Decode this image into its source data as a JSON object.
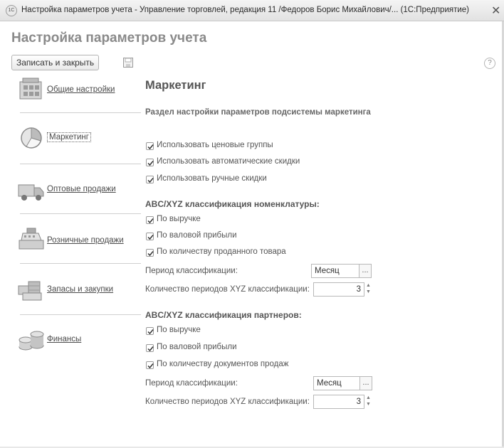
{
  "window": {
    "title": "Настройка параметров учета - Управление торговлей, редакция 11 /Федоров Борис Михайлович/... (1С:Предприятие)",
    "close_glyph": "✕",
    "logo_text": "1С"
  },
  "form": {
    "title": "Настройка параметров учета",
    "save_close_label": "Записать и закрыть",
    "help_glyph": "?"
  },
  "nav": {
    "items": [
      {
        "label": "Общие настройки",
        "icon": "general-settings-icon"
      },
      {
        "label": "Маркетинг",
        "icon": "marketing-icon",
        "active": true
      },
      {
        "label": "Оптовые продажи",
        "icon": "truck-icon"
      },
      {
        "label": "Розничные продажи",
        "icon": "cash-register-icon"
      },
      {
        "label": "Запасы и закупки",
        "icon": "warehouse-icon"
      },
      {
        "label": "Финансы",
        "icon": "coins-icon"
      }
    ]
  },
  "content": {
    "section_title": "Маркетинг",
    "section_subtitle": "Раздел настройки параметров подсистемы маркетинга",
    "general_checkboxes": [
      {
        "label": "Использовать ценовые группы",
        "checked": true
      },
      {
        "label": "Использовать автоматические скидки",
        "checked": true
      },
      {
        "label": "Использовать ручные скидки",
        "checked": true
      }
    ],
    "nomenclature_group": {
      "title": "ABC/XYZ классификация номенклатуры:",
      "checkboxes": [
        {
          "label": "По выручке",
          "checked": true
        },
        {
          "label": "По валовой прибыли",
          "checked": true
        },
        {
          "label": "По количеству проданного товара",
          "checked": true
        }
      ],
      "period_label": "Период классификации:",
      "period_value": "Месяц",
      "count_label": "Количество периодов XYZ классификации:",
      "count_value": "3"
    },
    "partners_group": {
      "title": "ABC/XYZ классификация партнеров:",
      "checkboxes": [
        {
          "label": "По выручке",
          "checked": true
        },
        {
          "label": "По валовой прибыли",
          "checked": true
        },
        {
          "label": "По количеству документов продаж",
          "checked": true
        }
      ],
      "period_label": "Период классификации:",
      "period_value": "Месяц",
      "count_label": "Количество периодов XYZ классификации:",
      "count_value": "3"
    },
    "select_glyph": "...",
    "spin_up_glyph": "▲",
    "spin_down_glyph": "▼"
  }
}
